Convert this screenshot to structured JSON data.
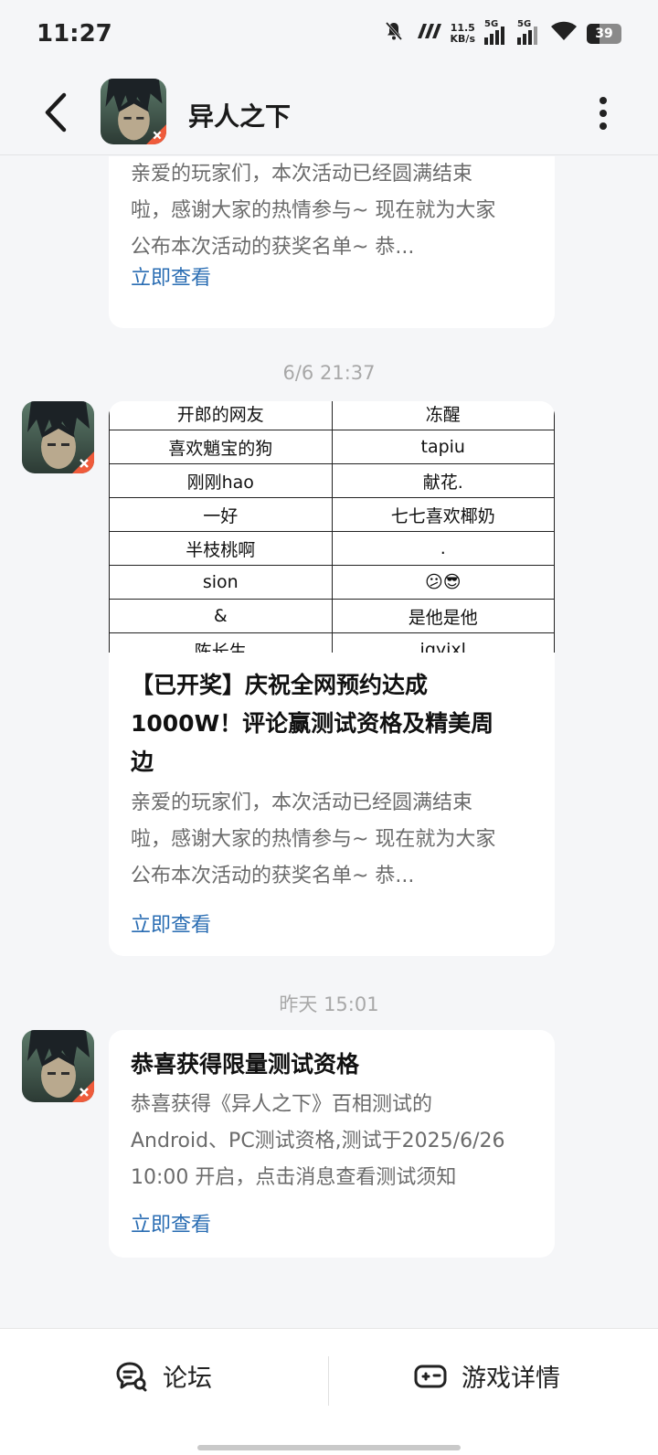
{
  "status_bar": {
    "time": "11:27",
    "speed_value": "11.5",
    "speed_unit": "KB/s",
    "sim1": "5G",
    "sim2": "5G",
    "battery": "39",
    "icons": [
      "mute-bell-icon",
      "nfc-icon",
      "signal-icon",
      "wifi-icon",
      "battery-icon"
    ]
  },
  "header": {
    "title": "异人之下",
    "back_icon": "chevron-left-icon",
    "more_icon": "more-vertical-icon"
  },
  "messages": [
    {
      "description": "亲爱的玩家们，本次活动已经圆满结束啦，感谢大家的热情参与~ 现在就为大家公布本次活动的获奖名单~ 恭...",
      "desc_lines": [
        "亲爱的玩家们，本次活动已经圆满结束",
        "啦，感谢大家的热情参与~ 现在就为大家",
        "公布本次活动的获奖名单~ 恭..."
      ],
      "link": "立即查看"
    },
    {
      "timestamp": "6/6  21:37",
      "table_rows": [
        [
          "开郎的网友",
          "冻醒"
        ],
        [
          "喜欢魈宝的狗",
          "tapiu"
        ],
        [
          "刚刚hao",
          "献花."
        ],
        [
          "一好",
          "七七喜欢椰奶"
        ],
        [
          "半枝桃啊",
          "."
        ],
        [
          "sion",
          "😕😎"
        ],
        [
          "&",
          "是他是他"
        ],
        [
          "陈长生",
          "jqyixl"
        ]
      ],
      "title_lines": [
        "【已开奖】庆祝全网预约达成",
        "1000W！评论赢测试资格及精美周",
        "边"
      ],
      "desc_lines": [
        "亲爱的玩家们，本次活动已经圆满结束",
        "啦，感谢大家的热情参与~ 现在就为大家",
        "公布本次活动的获奖名单~ 恭..."
      ],
      "link": "立即查看"
    },
    {
      "timestamp": "昨天  15:01",
      "title": "恭喜获得限量测试资格",
      "desc_lines": [
        "恭喜获得《异人之下》百相测试的",
        "Android、PC测试资格,测试于2025/6/26",
        "10:00 开启，点击消息查看测试须知"
      ],
      "link": "立即查看"
    }
  ],
  "bottom_bar": {
    "forum_label": "论坛",
    "forum_icon": "forum-chat-icon",
    "game_label": "游戏详情",
    "game_icon": "gamepad-icon"
  }
}
